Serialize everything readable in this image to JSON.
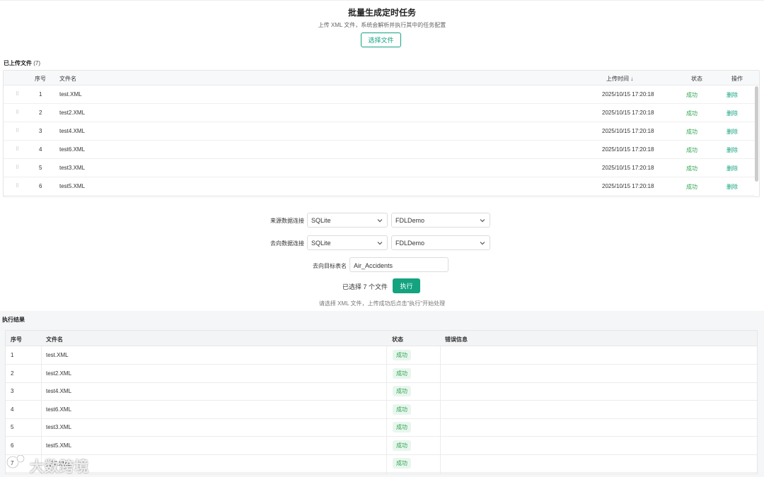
{
  "header": {
    "title": "批量生成定时任务",
    "subtitle": "上传 XML 文件，系统会解析并执行其中的任务配置",
    "choose_file_label": "选择文件"
  },
  "uploaded": {
    "title": "已上传文件",
    "count": "(7)",
    "columns": {
      "index": "序号",
      "filename": "文件名",
      "upload_time": "上传时间 ↓",
      "status": "状态",
      "actions": "操作"
    },
    "drag_icon": "drag-handle-icon",
    "rows": [
      {
        "index": "1",
        "filename": "test.XML",
        "time": "2025/10/15 17:20:18",
        "status": "成功",
        "action": "删除"
      },
      {
        "index": "2",
        "filename": "test2.XML",
        "time": "2025/10/15 17:20:18",
        "status": "成功",
        "action": "删除"
      },
      {
        "index": "3",
        "filename": "test4.XML",
        "time": "2025/10/15 17:20:18",
        "status": "成功",
        "action": "删除"
      },
      {
        "index": "4",
        "filename": "test6.XML",
        "time": "2025/10/15 17:20:18",
        "status": "成功",
        "action": "删除"
      },
      {
        "index": "5",
        "filename": "test3.XML",
        "time": "2025/10/15 17:20:18",
        "status": "成功",
        "action": "删除"
      },
      {
        "index": "6",
        "filename": "test5.XML",
        "time": "2025/10/15 17:20:18",
        "status": "成功",
        "action": "删除"
      }
    ]
  },
  "form": {
    "source_label": "来源数据连接",
    "source_type": "SQLite",
    "source_db": "FDLDemo",
    "target_label": "去向数据连接",
    "target_type": "SQLite",
    "target_db": "FDLDemo",
    "table_label": "去向目标表名",
    "table_value": "Air_Accidents",
    "selected_text": "已选择 7 个文件",
    "execute_label": "执行",
    "hint": "请选择 XML 文件，上传成功后点击\"执行\"开始处理"
  },
  "results": {
    "title": "执行结果",
    "columns": {
      "index": "序号",
      "filename": "文件名",
      "status": "状态",
      "error": "错误信息"
    },
    "rows": [
      {
        "index": "1",
        "filename": "test.XML",
        "status": "成功"
      },
      {
        "index": "2",
        "filename": "test2.XML",
        "status": "成功"
      },
      {
        "index": "3",
        "filename": "test4.XML",
        "status": "成功"
      },
      {
        "index": "4",
        "filename": "test6.XML",
        "status": "成功"
      },
      {
        "index": "5",
        "filename": "test3.XML",
        "status": "成功"
      },
      {
        "index": "6",
        "filename": "test5.XML",
        "status": "成功"
      },
      {
        "index": "7",
        "filename": "资料.XML",
        "status": "成功"
      }
    ]
  },
  "watermark": {
    "text": "大数跨境"
  },
  "colors": {
    "accent": "#14a37f",
    "success": "#2ea44f",
    "success_bg": "#e8f6ee"
  }
}
